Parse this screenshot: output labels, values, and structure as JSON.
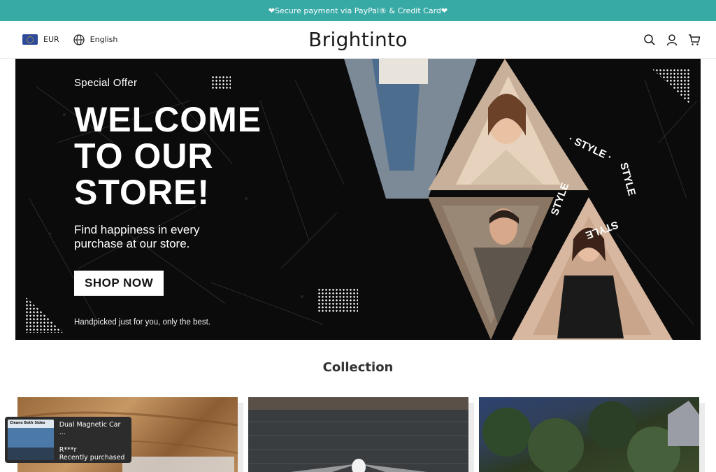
{
  "announcement": "❤Secure payment via PayPal® & Credit Card❤",
  "header": {
    "currency": "EUR",
    "language": "English",
    "logo": "Brightinto",
    "icons": [
      "search-icon",
      "account-icon",
      "cart-icon"
    ]
  },
  "hero": {
    "special_offer": "Special Offer",
    "headline_1": "WELCOME",
    "headline_2": "TO OUR",
    "headline_3": "STORE!",
    "subtext": "Find happiness in every purchase at our store.",
    "cta": "SHOP NOW",
    "tagline": "Handpicked just for you, only the best.",
    "ring_text": "· STYLE · STYLE · STYLE · STYLE"
  },
  "collection": {
    "title": "Collection"
  },
  "popup": {
    "image_tag": "Cleans Both Sides",
    "product": "Dual Magnetic Car ...",
    "buyer": "R***r",
    "status": "Recently purchased"
  },
  "colors": {
    "announcement_bg": "#38aaa6",
    "hero_bg": "#0b0b0b",
    "popup_bg": "#2c2c2c"
  }
}
